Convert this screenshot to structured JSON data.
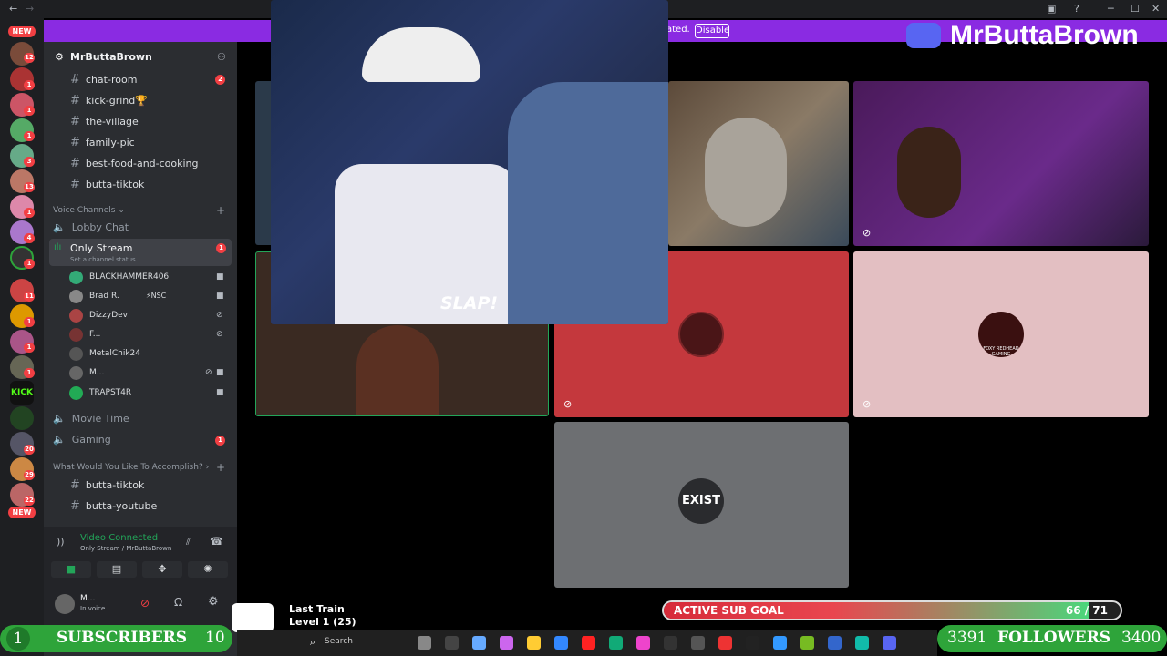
{
  "titlebar": {
    "back": "←",
    "forward": "→"
  },
  "notice": {
    "text": "ated.",
    "disable_label": "Disable"
  },
  "brand": {
    "name": "MrButtaBrown"
  },
  "rail": {
    "new_top": "NEW",
    "new_bottom": "NEW",
    "badges": [
      "12",
      "1",
      "1",
      "1",
      "3",
      "13",
      "1",
      "4",
      "1",
      "11",
      "1",
      "1",
      "1",
      "20",
      "29",
      "22"
    ]
  },
  "server": {
    "name": "MrButtaBrown"
  },
  "text_channels": [
    {
      "name": "chat-room",
      "badge": "2"
    },
    {
      "name": "kick-grind🏆"
    },
    {
      "name": "the-village"
    },
    {
      "name": "family-pic"
    },
    {
      "name": "best-food-and-cooking"
    },
    {
      "name": "butta-tiktok"
    }
  ],
  "voice_category": "Voice Channels",
  "voice_channels": {
    "lobby": "Lobby Chat",
    "only_stream": "Only Stream",
    "only_stream_badge": "1",
    "status": "Set a channel status",
    "members": [
      "BLACKHAMMER406",
      "Brad R.",
      "DizzyDev",
      "F...",
      "MetalChik24",
      "M...",
      "TRAPST4R"
    ],
    "brad_tag": "⚡NSC",
    "movie": "Movie Time",
    "gaming": "Gaming",
    "gaming_badge": "1"
  },
  "category2": "What Would You Like To Accomplish?",
  "text_channels2": [
    "butta-tiktok",
    "butta-youtube"
  ],
  "voice_panel": {
    "status": "Video Connected",
    "location": "Only Stream / MrButtaBrown"
  },
  "user_panel": {
    "name": "M...",
    "status": "In voice"
  },
  "tiles": {
    "slap_caption": "SLAP!",
    "exist_label": "EXIST",
    "foxy_label": "FOXY REDHEAD GAMING"
  },
  "song": {
    "title": "Last Train",
    "level": "Level 1 (25)"
  },
  "taskbar": {
    "search_placeholder": "Search"
  },
  "subscribers": {
    "current": "1",
    "label": "SUBSCRIBERS",
    "goal": "10"
  },
  "sub_goal": {
    "label": "ACTIVE SUB GOAL",
    "value": "66 / 71",
    "progress": 0.93
  },
  "followers": {
    "current": "3391",
    "label": "FOLLOWERS",
    "goal": "3400"
  },
  "colors": {
    "accent": "#5865f2",
    "notice": "#8a2be2",
    "goal_green": "#2ea43a",
    "mute_red": "#f23f43"
  }
}
